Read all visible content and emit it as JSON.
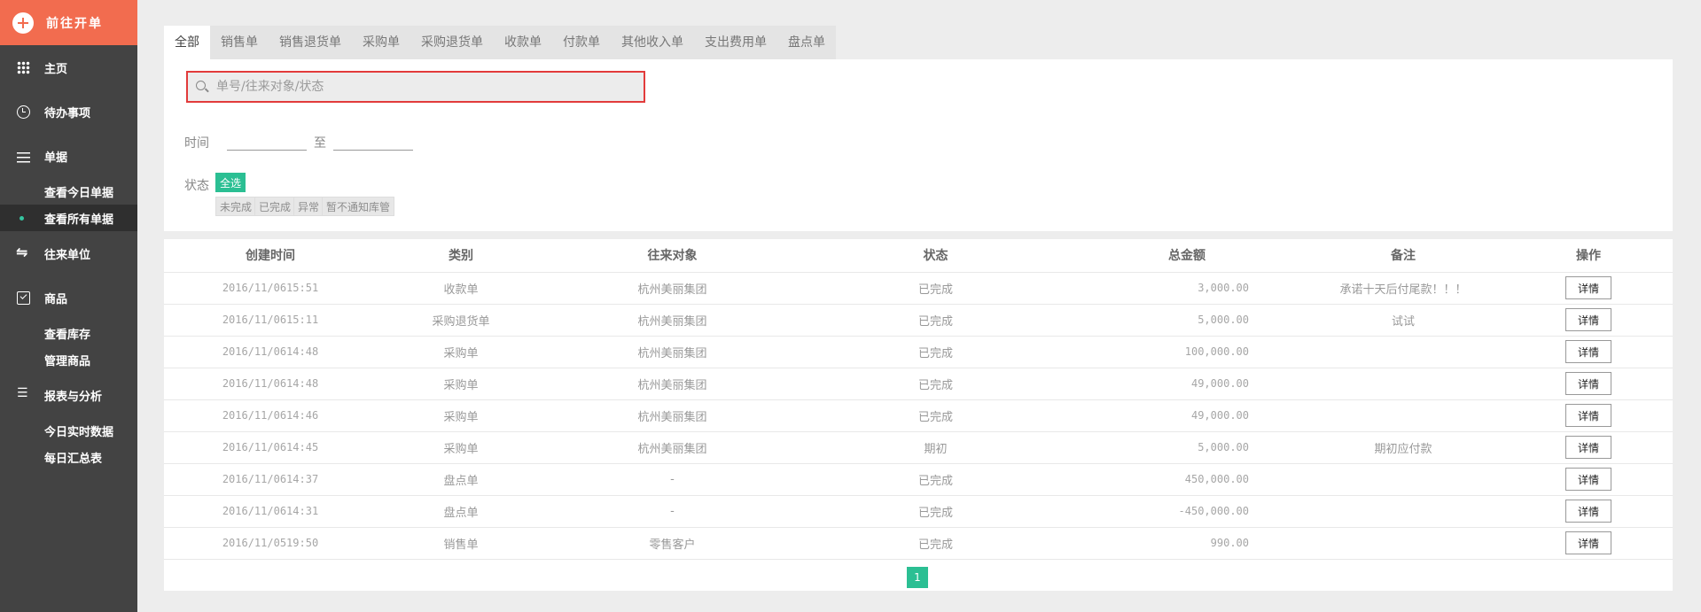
{
  "sidebar": {
    "new_order": "前往开单",
    "items": [
      {
        "label": "主页",
        "icon": "grid-icon"
      },
      {
        "label": "待办事项",
        "icon": "clock-icon"
      },
      {
        "label": "单据",
        "icon": "list-icon"
      },
      {
        "label": "查看今日单据",
        "sub": true
      },
      {
        "label": "查看所有单据",
        "sub": true,
        "active": true
      },
      {
        "label": "往来单位",
        "icon": "swap-icon"
      },
      {
        "label": "商品",
        "icon": "check-icon"
      },
      {
        "label": "查看库存",
        "sub": true
      },
      {
        "label": "管理商品",
        "sub": true
      },
      {
        "label": "报表与分析",
        "icon": "report-icon"
      },
      {
        "label": "今日实时数据",
        "sub": true
      },
      {
        "label": "每日汇总表",
        "sub": true
      }
    ]
  },
  "tabs": [
    "全部",
    "销售单",
    "销售退货单",
    "采购单",
    "采购退货单",
    "收款单",
    "付款单",
    "其他收入单",
    "支出费用单",
    "盘点单"
  ],
  "active_tab": "全部",
  "search": {
    "placeholder": "单号/往来对象/状态",
    "value": ""
  },
  "filters": {
    "time_label": "时间",
    "time_sep": "至",
    "status_label": "状态",
    "status_all": "全选",
    "status_options": [
      "未完成",
      "已完成",
      "异常",
      "暂不通知库管"
    ]
  },
  "table": {
    "headers": [
      "创建时间",
      "类别",
      "往来对象",
      "状态",
      "总金额",
      "备注",
      "操作"
    ],
    "action_label": "详情",
    "rows": [
      [
        "2016/11/0615:51",
        "收款单",
        "杭州美丽集团",
        "已完成",
        "3,000.00",
        "承诺十天后付尾款！！！"
      ],
      [
        "2016/11/0615:11",
        "采购退货单",
        "杭州美丽集团",
        "已完成",
        "5,000.00",
        "试试"
      ],
      [
        "2016/11/0614:48",
        "采购单",
        "杭州美丽集团",
        "已完成",
        "100,000.00",
        ""
      ],
      [
        "2016/11/0614:48",
        "采购单",
        "杭州美丽集团",
        "已完成",
        "49,000.00",
        ""
      ],
      [
        "2016/11/0614:46",
        "采购单",
        "杭州美丽集团",
        "已完成",
        "49,000.00",
        ""
      ],
      [
        "2016/11/0614:45",
        "采购单",
        "杭州美丽集团",
        "期初",
        "5,000.00",
        "期初应付款"
      ],
      [
        "2016/11/0614:37",
        "盘点单",
        "-",
        "已完成",
        "450,000.00",
        ""
      ],
      [
        "2016/11/0614:31",
        "盘点单",
        "-",
        "已完成",
        "-450,000.00",
        ""
      ],
      [
        "2016/11/0519:50",
        "销售单",
        "零售客户",
        "已完成",
        "990.00",
        ""
      ]
    ]
  },
  "pagination": {
    "current": "1"
  },
  "colors": {
    "accent": "#f26c4f",
    "green": "#2bbf93",
    "sidebar": "#434343",
    "highlight_border": "#e23b3b"
  }
}
